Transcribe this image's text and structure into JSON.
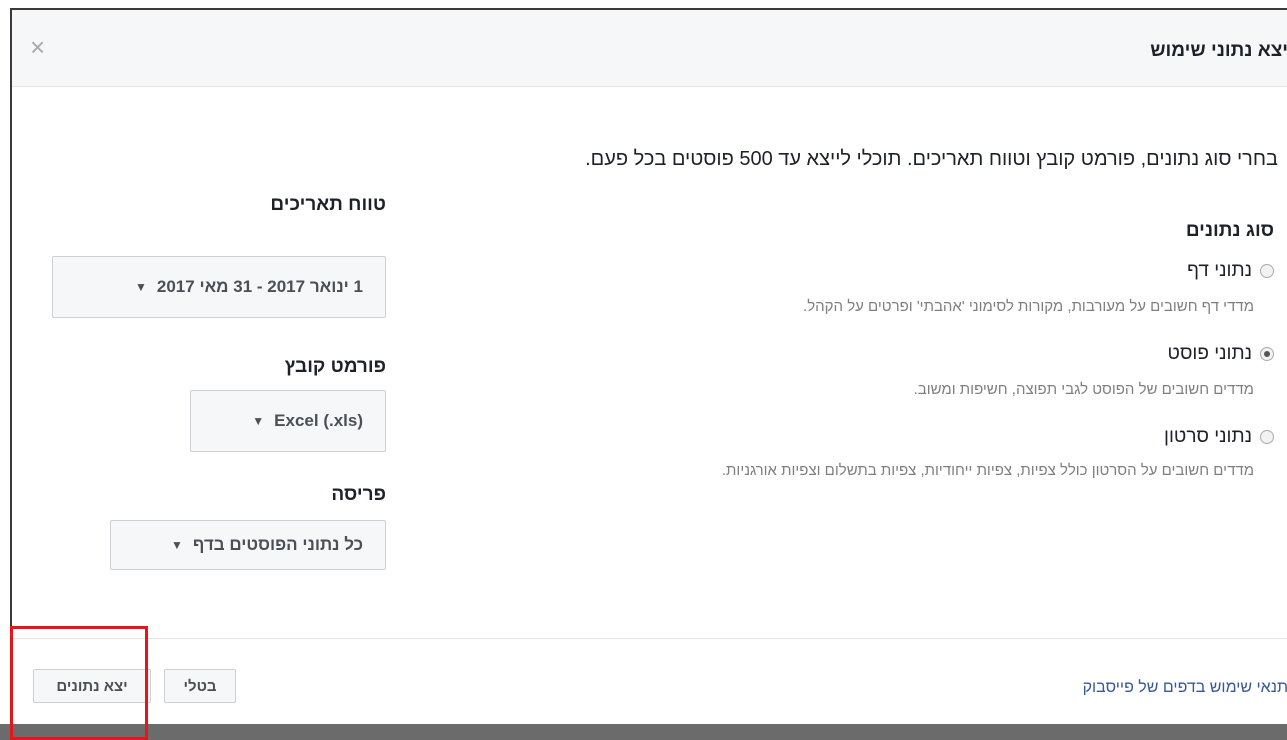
{
  "dialog": {
    "title": "יצא נתוני שימוש",
    "close_symbol": "×",
    "description": "בחרי סוג נתונים, פורמט קובץ וטווח תאריכים. תוכלי לייצא עד 500 פוסטים בכל פעם."
  },
  "data_type": {
    "heading": "סוג נתונים",
    "options": [
      {
        "label": "נתוני דף",
        "description": "מדדי דף חשובים על מעורבות, מקורות לסימוני 'אהבתי' ופרטים על הקהל.",
        "selected": false
      },
      {
        "label": "נתוני פוסט",
        "description": "מדדים חשובים של הפוסט לגבי תפוצה, חשיפות ומשוב.",
        "selected": true
      },
      {
        "label": "נתוני סרטון",
        "description": "מדדים חשובים על הסרטון כולל צפיות, צפיות ייחודיות, צפיות בתשלום וצפיות אורגניות.",
        "selected": false
      }
    ]
  },
  "date_range": {
    "heading": "טווח תאריכים",
    "value": "1 ינואר 2017 - 31 מאי 2017"
  },
  "file_format": {
    "heading": "פורמט קובץ",
    "value": "Excel (.xls)"
  },
  "layout_option": {
    "heading": "פריסה",
    "value": "כל נתוני הפוסטים בדף"
  },
  "footer": {
    "terms_link": "תנאי שימוש בדפים של פייסבוק",
    "cancel_label": "בטלי",
    "export_label": "יצא נתונים"
  },
  "colors": {
    "highlight": "#e8141b",
    "link": "#365899"
  },
  "icons": {
    "close": "close-icon",
    "caret": "caret-down-icon"
  }
}
